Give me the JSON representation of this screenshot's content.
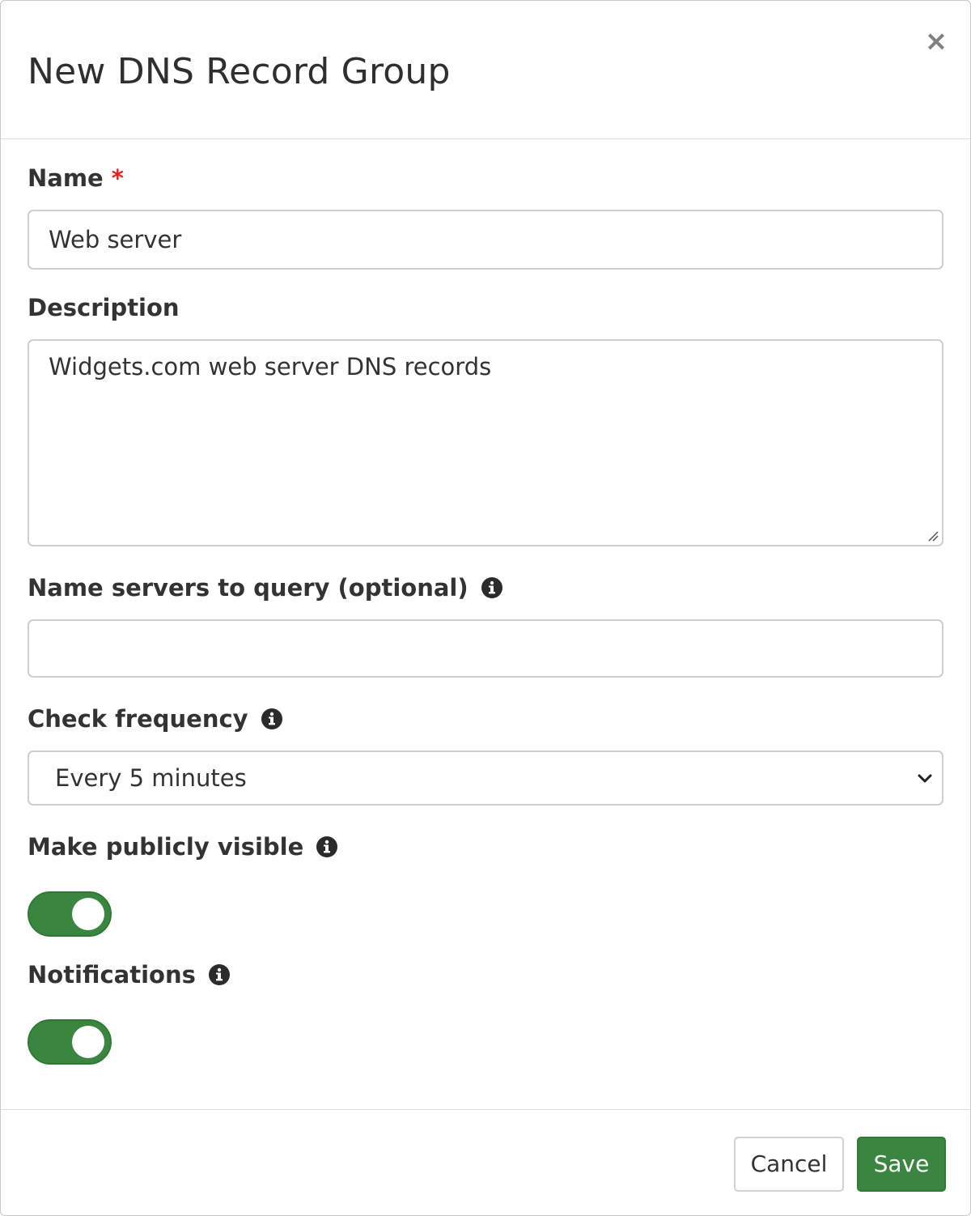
{
  "dialog": {
    "title": "New DNS Record Group",
    "close_symbol": "×"
  },
  "form": {
    "name": {
      "label": "Name",
      "required_mark": "*",
      "value": "Web server"
    },
    "description": {
      "label": "Description",
      "value": "Widgets.com web server DNS records"
    },
    "name_servers": {
      "label": "Name servers to query (optional)",
      "value": "",
      "icon": "info-icon"
    },
    "check_frequency": {
      "label": "Check frequency",
      "selected": "Every 5 minutes",
      "icon": "info-icon"
    },
    "public": {
      "label": "Make publicly visible",
      "enabled": true,
      "icon": "info-icon"
    },
    "notifications": {
      "label": "Notifications",
      "enabled": true,
      "icon": "info-icon"
    }
  },
  "footer": {
    "cancel_label": "Cancel",
    "save_label": "Save"
  },
  "colors": {
    "accent": "#3a8640",
    "required": "#e0241b"
  }
}
